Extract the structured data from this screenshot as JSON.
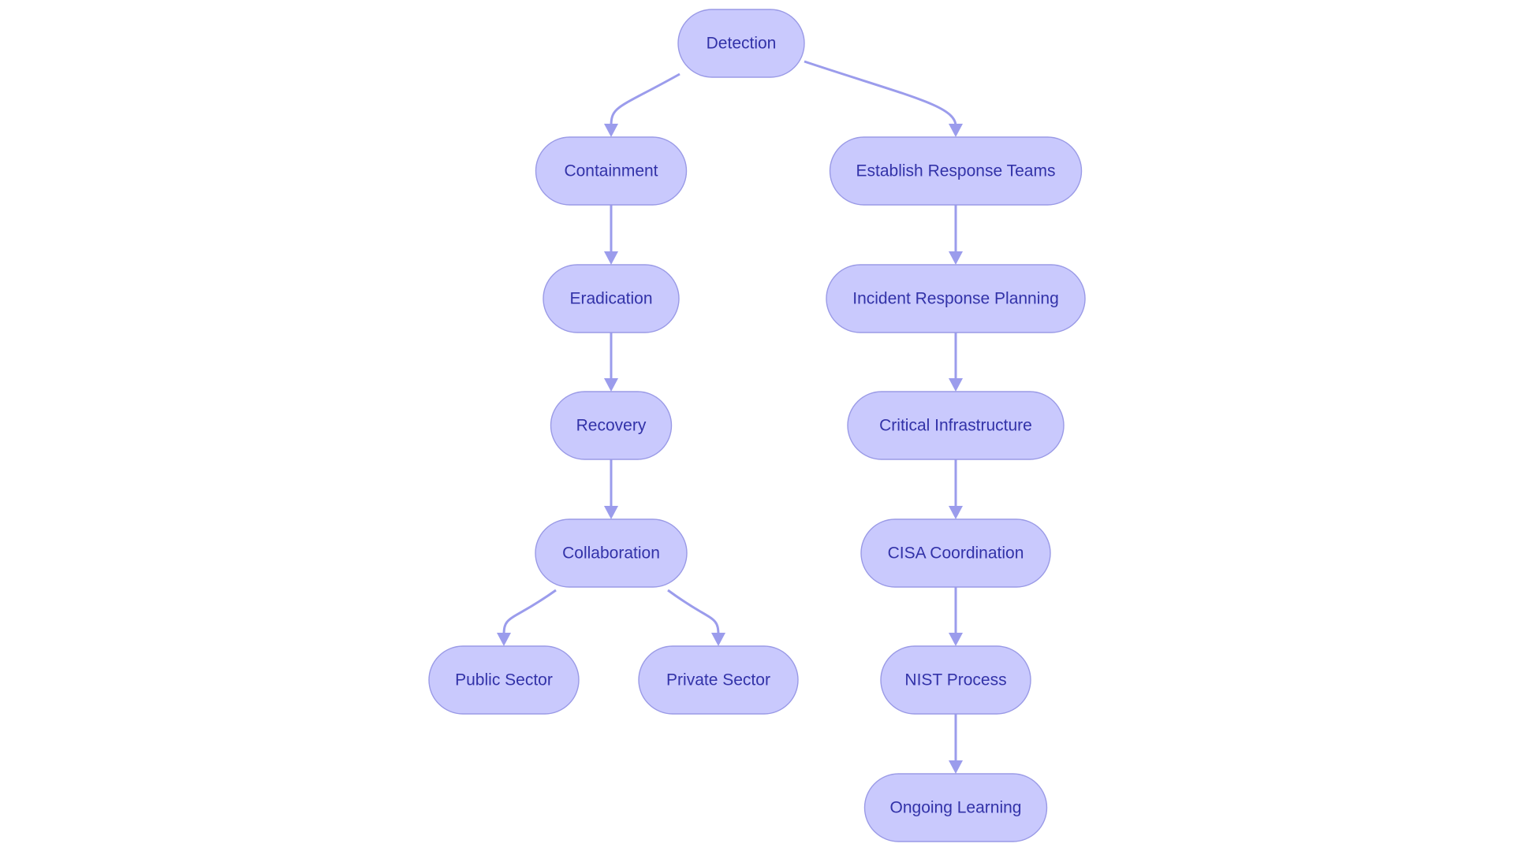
{
  "diagram": {
    "type": "flowchart",
    "direction": "top-down",
    "colors": {
      "node_fill": "#c9c9fd",
      "node_border": "#9a9ae6",
      "node_text": "#3232a8",
      "edge": "#9b9cec",
      "background": "#ffffff"
    },
    "nodes": [
      {
        "id": "detection",
        "label": "Detection"
      },
      {
        "id": "containment",
        "label": "Containment"
      },
      {
        "id": "eradication",
        "label": "Eradication"
      },
      {
        "id": "recovery",
        "label": "Recovery"
      },
      {
        "id": "collaboration",
        "label": "Collaboration"
      },
      {
        "id": "public_sector",
        "label": "Public Sector"
      },
      {
        "id": "private_sector",
        "label": "Private Sector"
      },
      {
        "id": "establish_teams",
        "label": "Establish Response Teams"
      },
      {
        "id": "ir_planning",
        "label": "Incident Response Planning"
      },
      {
        "id": "critical_infra",
        "label": "Critical Infrastructure"
      },
      {
        "id": "cisa",
        "label": "CISA Coordination"
      },
      {
        "id": "nist",
        "label": "NIST Process"
      },
      {
        "id": "ongoing_learning",
        "label": "Ongoing Learning"
      }
    ],
    "edges": [
      {
        "from": "detection",
        "to": "containment"
      },
      {
        "from": "detection",
        "to": "establish_teams"
      },
      {
        "from": "containment",
        "to": "eradication"
      },
      {
        "from": "eradication",
        "to": "recovery"
      },
      {
        "from": "recovery",
        "to": "collaboration"
      },
      {
        "from": "collaboration",
        "to": "public_sector"
      },
      {
        "from": "collaboration",
        "to": "private_sector"
      },
      {
        "from": "establish_teams",
        "to": "ir_planning"
      },
      {
        "from": "ir_planning",
        "to": "critical_infra"
      },
      {
        "from": "critical_infra",
        "to": "cisa"
      },
      {
        "from": "cisa",
        "to": "nist"
      },
      {
        "from": "nist",
        "to": "ongoing_learning"
      }
    ]
  }
}
